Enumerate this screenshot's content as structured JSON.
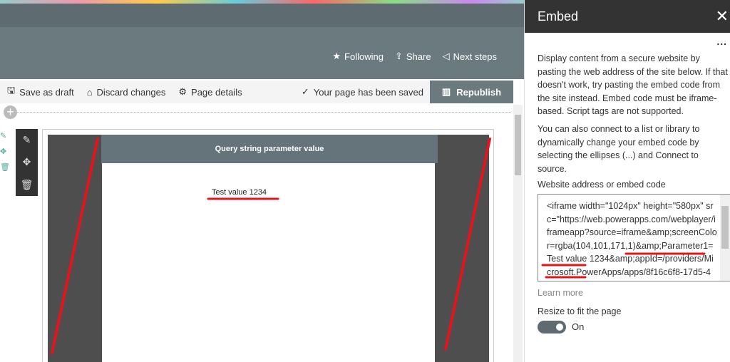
{
  "header": {
    "following": "Following",
    "share": "Share",
    "next_steps": "Next steps"
  },
  "commandbar": {
    "save_draft": "Save as draft",
    "discard": "Discard changes",
    "page_details": "Page details",
    "saved_status": "Your page has been saved",
    "republish": "Republish"
  },
  "webpart": {
    "app_title": "Query string parameter value",
    "test_value": "Test value 1234"
  },
  "panel": {
    "title": "Embed",
    "description": "Display content from a secure website by pasting the web address of the site below. If that doesn't work, try pasting the embed code from the site instead. Embed code must be iframe-based. Script tags are not supported.",
    "description2": "You can also connect to a list or library to dynamically change your embed code by selecting the ellipses (...) and Connect to source.",
    "field_label": "Website address or embed code",
    "embed_code": "<iframe width=\"1024px\" height=\"580px\" src=\"https://web.powerapps.com/webplayer/iframeapp?source=iframe&amp;screenColor=rgba(104,101,171,1)&amp;Parameter1=Test value 1234&amp;appId=/providers/Microsoft.PowerApps/apps/8f16c6f8-17d5-4",
    "learn_more": "Learn more",
    "resize_label": "Resize to fit the page",
    "resize_toggle": "On",
    "resize_on": true
  },
  "colors": {
    "header": "#6b7a7f",
    "panel_header": "#333333",
    "annotation": "#e3141c"
  }
}
